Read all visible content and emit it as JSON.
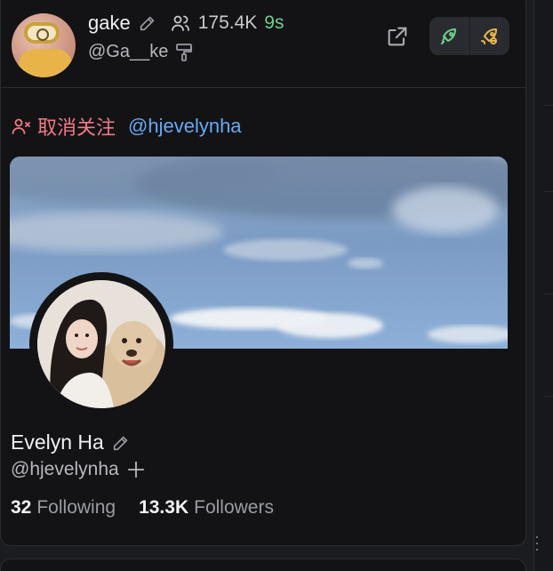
{
  "account": {
    "name": "gake",
    "followers": "175.4K",
    "time_ago": "9s",
    "handle": "@Ga__ke"
  },
  "actions": {
    "unfollow_label": "取消关注",
    "mention": "@hjevelynha"
  },
  "profile": {
    "name": "Evelyn Ha",
    "handle": "@hjevelynha",
    "following_count": "32",
    "following_label": "Following",
    "followers_count": "13.3K",
    "followers_label": "Followers"
  },
  "icons": {
    "edit": "pencil-icon",
    "followers": "users-icon",
    "pin": "paint-roller-icon",
    "external": "external-link-icon",
    "boost": "rocket-icon",
    "boost_alt": "rocket-fire-icon",
    "unfollow": "user-x-icon",
    "add": "plus-icon"
  },
  "colors": {
    "unfollow": "#f07a86",
    "mention": "#67a9f5",
    "time": "#6fd08c",
    "rocket_green": "#6fd08c",
    "rocket_gold": "#e8b84a"
  }
}
